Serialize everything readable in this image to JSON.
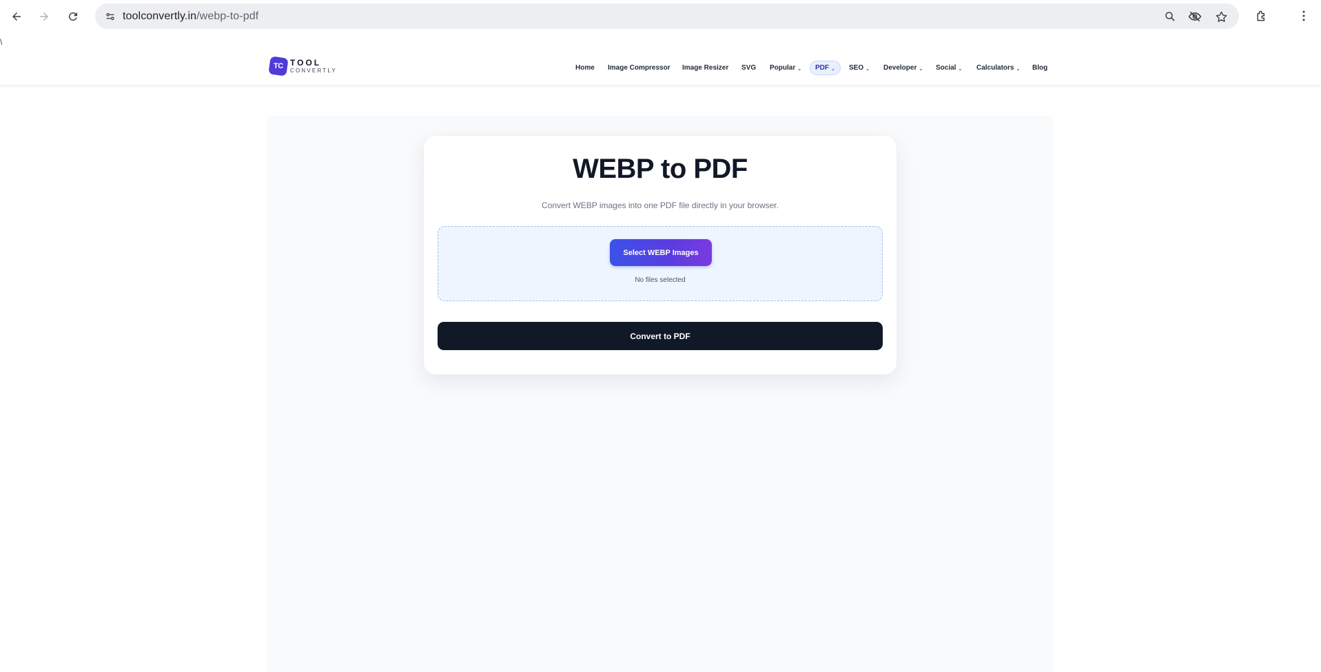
{
  "browser": {
    "url_host": "toolconvertly.in",
    "url_path": "/webp-to-pdf",
    "icons": [
      "back-arrow-icon",
      "forward-arrow-icon",
      "reload-icon",
      "site-info-icon",
      "zoom-icon",
      "eye-off-icon",
      "star-icon",
      "extensions-icon",
      "menu-icon"
    ],
    "stray_char": "\\"
  },
  "header": {
    "logo_mark": "TC",
    "logo_line1": "TOOL",
    "logo_line2": "CONVERTLY",
    "nav": [
      {
        "label": "Home",
        "dropdown": false
      },
      {
        "label": "Image Compressor",
        "dropdown": false
      },
      {
        "label": "Image Resizer",
        "dropdown": false
      },
      {
        "label": "SVG",
        "dropdown": false
      },
      {
        "label": "Popular",
        "dropdown": true
      },
      {
        "label": "PDF",
        "dropdown": true,
        "active": true
      },
      {
        "label": "SEO",
        "dropdown": true
      },
      {
        "label": "Developer",
        "dropdown": true
      },
      {
        "label": "Social",
        "dropdown": true
      },
      {
        "label": "Calculators",
        "dropdown": true
      },
      {
        "label": "Blog",
        "dropdown": false
      }
    ],
    "chevron": "⌄"
  },
  "tool": {
    "title": "WEBP to PDF",
    "subtitle": "Convert WEBP images into one PDF file directly in your browser.",
    "select_button": "Select WEBP Images",
    "file_status": "No files selected",
    "convert_button": "Convert to PDF"
  },
  "colors": {
    "brand": "#4f3bd8",
    "primary_gradient_start": "#3b52e8",
    "primary_gradient_end": "#7b3be0",
    "dark_button": "#111827",
    "dropzone_bg": "#eef5ff"
  }
}
